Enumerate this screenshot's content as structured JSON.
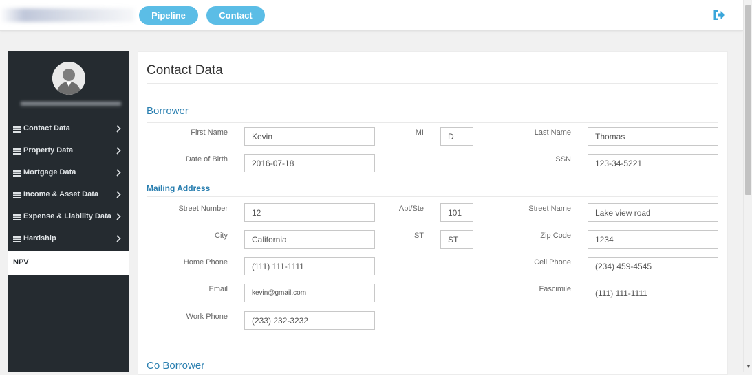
{
  "header": {
    "nav_buttons": {
      "pipeline": "Pipeline",
      "contact": "Contact"
    },
    "logout_icon": "sign-out-icon"
  },
  "colors": {
    "accent": "#5bbde6",
    "sidebar_bg": "#252b30",
    "section_title": "#2a7fb0",
    "logout_icon": "#3aa6da"
  },
  "sidebar": {
    "items": [
      {
        "label": "Contact Data",
        "icon": "list-icon",
        "chevron": "chevron-right-icon"
      },
      {
        "label": "Property Data",
        "icon": "list-icon",
        "chevron": "chevron-right-icon"
      },
      {
        "label": "Mortgage Data",
        "icon": "list-icon",
        "chevron": "chevron-right-icon"
      },
      {
        "label": "Income & Asset Data",
        "icon": "list-icon",
        "chevron": "chevron-right-icon"
      },
      {
        "label": "Expense & Liability Data",
        "icon": "list-icon",
        "chevron": "chevron-right-icon"
      },
      {
        "label": "Hardship",
        "icon": "list-icon",
        "chevron": "chevron-right-icon"
      }
    ],
    "active_item": "NPV"
  },
  "main": {
    "title": "Contact Data",
    "borrower": {
      "title": "Borrower",
      "fields": {
        "first_name": {
          "label": "First Name",
          "value": "Kevin"
        },
        "mi": {
          "label": "MI",
          "value": "D"
        },
        "last_name": {
          "label": "Last Name",
          "value": "Thomas"
        },
        "dob": {
          "label": "Date of Birth",
          "value": "2016-07-18"
        },
        "ssn": {
          "label": "SSN",
          "value": "123-34-5221"
        }
      }
    },
    "mailing": {
      "title": "Mailing Address",
      "fields": {
        "street_number": {
          "label": "Street Number",
          "value": "12"
        },
        "apt": {
          "label": "Apt/Ste",
          "value": "101"
        },
        "street_name": {
          "label": "Street Name",
          "value": "Lake view road"
        },
        "city": {
          "label": "City",
          "value": "California"
        },
        "st": {
          "label": "ST",
          "value": "ST"
        },
        "zip": {
          "label": "Zip Code",
          "value": "1234"
        },
        "home_phone": {
          "label": "Home Phone",
          "value": "(111) 111-1111"
        },
        "cell_phone": {
          "label": "Cell Phone",
          "value": "(234) 459-4545"
        },
        "email": {
          "label": "Email",
          "value": "kevin@gmail.com"
        },
        "fax": {
          "label": "Fascimile",
          "value": "(111) 111-1111"
        },
        "work_phone": {
          "label": "Work Phone",
          "value": "(233) 232-3232"
        }
      }
    },
    "co_borrower": {
      "title": "Co Borrower"
    }
  }
}
